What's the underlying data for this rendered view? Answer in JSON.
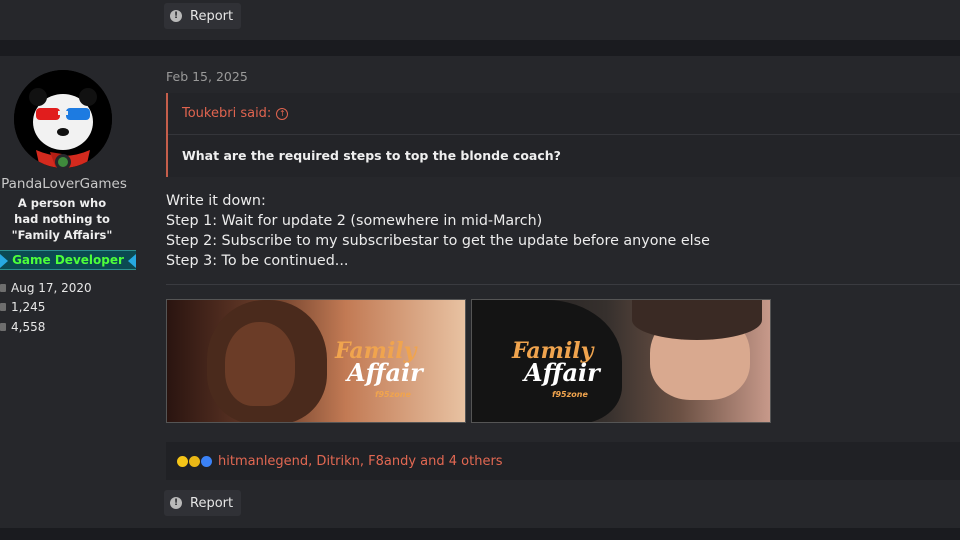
{
  "top_post": {
    "report_label": "Report"
  },
  "user": {
    "username": "PandaLoverGames",
    "title": "A person who had nothing to \"Family Affairs\"",
    "banner": "Game Developer",
    "joined": "Aug 17, 2020",
    "messages": "1,245",
    "reaction_score": "4,558"
  },
  "post": {
    "date": "Feb 15, 2025",
    "quote": {
      "author_line": "Toukebri said:",
      "text": "What are the required steps to top the blonde coach?"
    },
    "body_lines": [
      "Write it down:",
      "Step 1: Wait for update 2 (somewhere in mid-March)",
      "Step 2: Subscribe to my subscribestar to get the update before anyone else",
      "Step 3: To be continued..."
    ],
    "images": [
      {
        "logo_l1": "Family",
        "logo_l2": "Affair",
        "logo_l3": "f95zone"
      },
      {
        "logo_l1": "Family",
        "logo_l2": "Affair",
        "logo_l3": "f95zone"
      }
    ],
    "reactions": {
      "icons": [
        "laugh-emoji-icon",
        "sad-emoji-icon",
        "like-icon"
      ],
      "text": "hitmanlegend, Ditrikn, F8andy and 4 others"
    },
    "report_label": "Report"
  },
  "colors": {
    "accent": "#e0644f",
    "background": "#26272b",
    "banner_text": "#4dff3a"
  }
}
